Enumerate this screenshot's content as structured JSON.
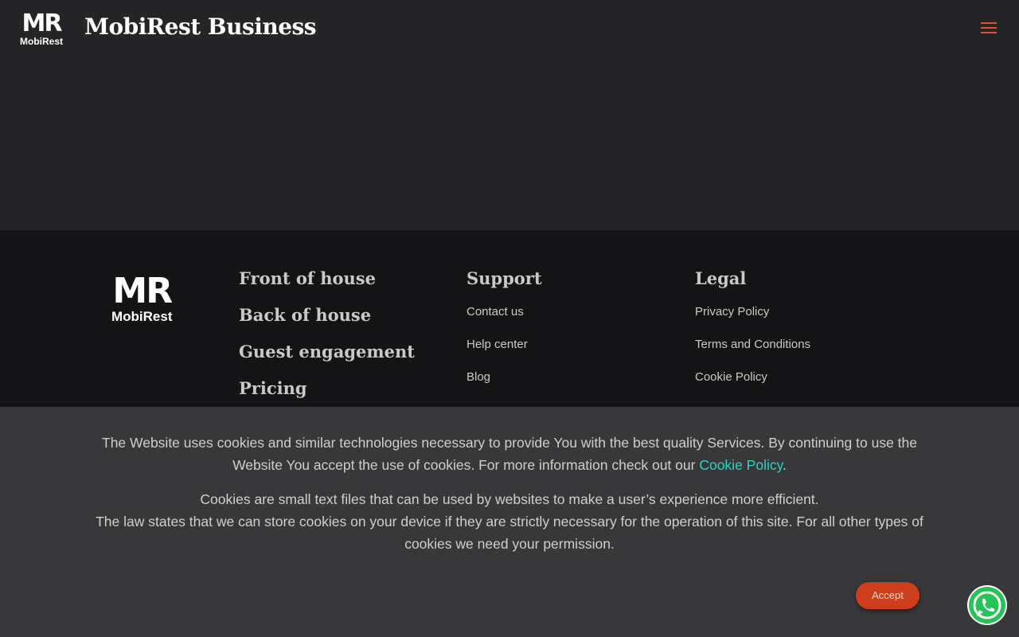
{
  "header": {
    "logo_mark": "MR",
    "logo_text": "MobiRest",
    "brand_name": "MobiRest Business"
  },
  "footer": {
    "logo_mark": "MR",
    "logo_text": "MobiRest",
    "nav": {
      "items": [
        "Front of house",
        "Back of house",
        "Guest engagement",
        "Pricing"
      ]
    },
    "support": {
      "title": "Support",
      "links": [
        "Contact us",
        "Help center",
        "Blog"
      ]
    },
    "legal": {
      "title": "Legal",
      "links": [
        "Privacy Policy",
        "Terms and Conditions",
        "Cookie Policy"
      ]
    }
  },
  "cookie_banner": {
    "paragraph1_text": "The Website uses cookies and similar technologies necessary to provide You with the best quality Services. By continuing to use the Website You accept the use of cookies. For more information check out our",
    "paragraph1_link": "Cookie Policy",
    "paragraph1_end": ".",
    "paragraph2_line1": "Cookies are small text files that can be used by websites to make a user’s experience more efficient.",
    "paragraph2_line2": "The law states that we can store cookies on your device if they are strictly necessary for the operation of this site. For all other types of cookies we need your permission.",
    "accept_label": "Accept"
  },
  "colors": {
    "accent": "#cf3e1c",
    "menu": "#e2502b",
    "link": "#2ed3c0",
    "whatsapp": "#25c256"
  },
  "icons": {
    "menu": "hamburger-menu-icon",
    "whatsapp": "whatsapp-icon"
  }
}
